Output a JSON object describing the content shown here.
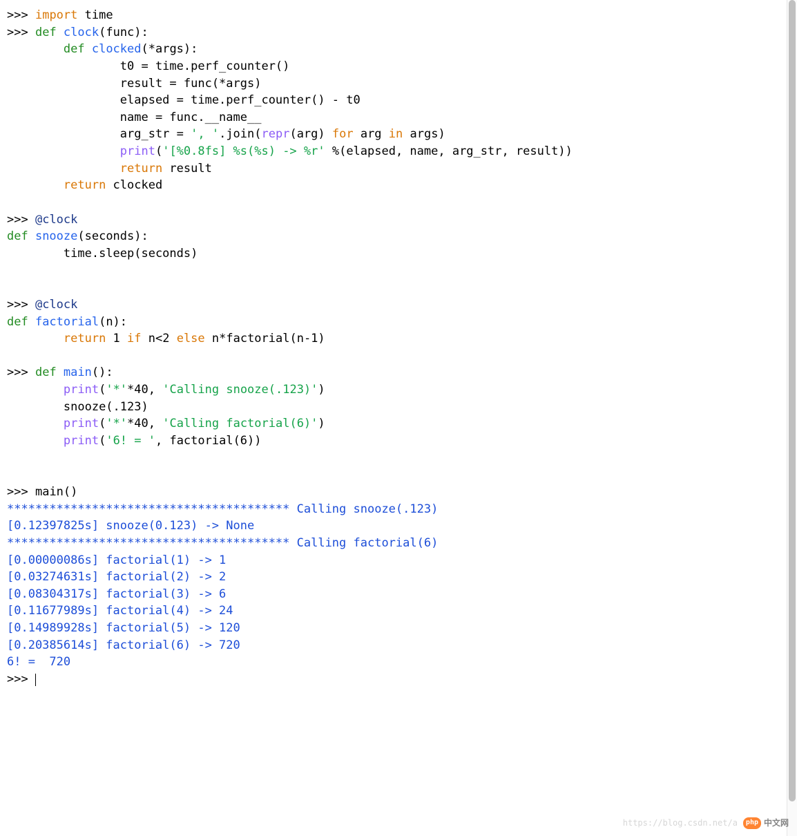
{
  "colors": {
    "keyword_orange": "#d97706",
    "keyword_green": "#228b22",
    "func_blue": "#2563eb",
    "def_blue": "#1e3a8a",
    "call_purple": "#8b5cf6",
    "string_green": "#16a34a",
    "output_blue": "#1d4ed8"
  },
  "prompt": ">>>",
  "code": {
    "line1": {
      "kw_import": "import",
      "mod": " time"
    },
    "line2": {
      "kw_def": "def",
      "name": " clock",
      "params": "(func):"
    },
    "line3": {
      "indent": "        ",
      "kw_def": "def",
      "name": " clocked",
      "params": "(*args):"
    },
    "line4": {
      "indent": "                ",
      "text": "t0 = time.perf_counter()"
    },
    "line5": {
      "indent": "                ",
      "text": "result = func(*args)"
    },
    "line6": {
      "indent": "                ",
      "text": "elapsed = time.perf_counter() - t0"
    },
    "line7": {
      "indent": "                ",
      "text": "name = func.__name__"
    },
    "line8": {
      "indent": "                ",
      "pre": "arg_str = ",
      "str": "', '",
      "mid": ".join(",
      "call": "repr",
      "post1": "(arg) ",
      "kw_for": "for",
      "post2": " arg ",
      "kw_in": "in",
      "post3": " args)"
    },
    "line9": {
      "indent": "                ",
      "call": "print",
      "lp": "(",
      "str": "'[%0.8fs] %s(%s) -> %r'",
      "post": " %(elapsed, name, arg_str, result))"
    },
    "line10": {
      "indent": "                ",
      "kw": "return",
      "post": " result"
    },
    "line11": {
      "indent": "        ",
      "kw": "return",
      "post": " clocked"
    },
    "line12": {
      "deco": "@clock"
    },
    "line13": {
      "kw_def": "def",
      "name": " snooze",
      "params": "(seconds):"
    },
    "line14": {
      "indent": "        ",
      "text": "time.sleep(seconds)"
    },
    "line15": {
      "deco": "@clock"
    },
    "line16": {
      "kw_def": "def",
      "name": " factorial",
      "params": "(n):"
    },
    "line17": {
      "indent": "        ",
      "kw_return": "return",
      "post1": " 1 ",
      "kw_if": "if",
      "post2": " n<2 ",
      "kw_else": "else",
      "post3": " n*factorial(n-1)"
    },
    "line18": {
      "kw_def": "def",
      "name": " main",
      "params": "():"
    },
    "line19": {
      "indent": "        ",
      "call": "print",
      "lp": "(",
      "str1": "'*'",
      "mid": "*40, ",
      "str2": "'Calling snooze(.123)'",
      "rp": ")"
    },
    "line20": {
      "indent": "        ",
      "text": "snooze(.123)"
    },
    "line21": {
      "indent": "        ",
      "call": "print",
      "lp": "(",
      "str1": "'*'",
      "mid": "*40, ",
      "str2": "'Calling factorial(6)'",
      "rp": ")"
    },
    "line22": {
      "indent": "        ",
      "call": "print",
      "lp": "(",
      "str": "'6! = '",
      "post": ", factorial(6))"
    },
    "line23": {
      "text": "main()"
    }
  },
  "output": [
    "**************************************** Calling snooze(.123)",
    "[0.12397825s] snooze(0.123) -> None",
    "**************************************** Calling factorial(6)",
    "[0.00000086s] factorial(1) -> 1",
    "[0.03274631s] factorial(2) -> 2",
    "[0.08304317s] factorial(3) -> 6",
    "[0.11677989s] factorial(4) -> 24",
    "[0.14989928s] factorial(5) -> 120",
    "[0.20385614s] factorial(6) -> 720",
    "6! =  720"
  ],
  "watermark": {
    "faded": "https://blog.csdn.net/a",
    "badge": "php",
    "cn": "中文网"
  }
}
